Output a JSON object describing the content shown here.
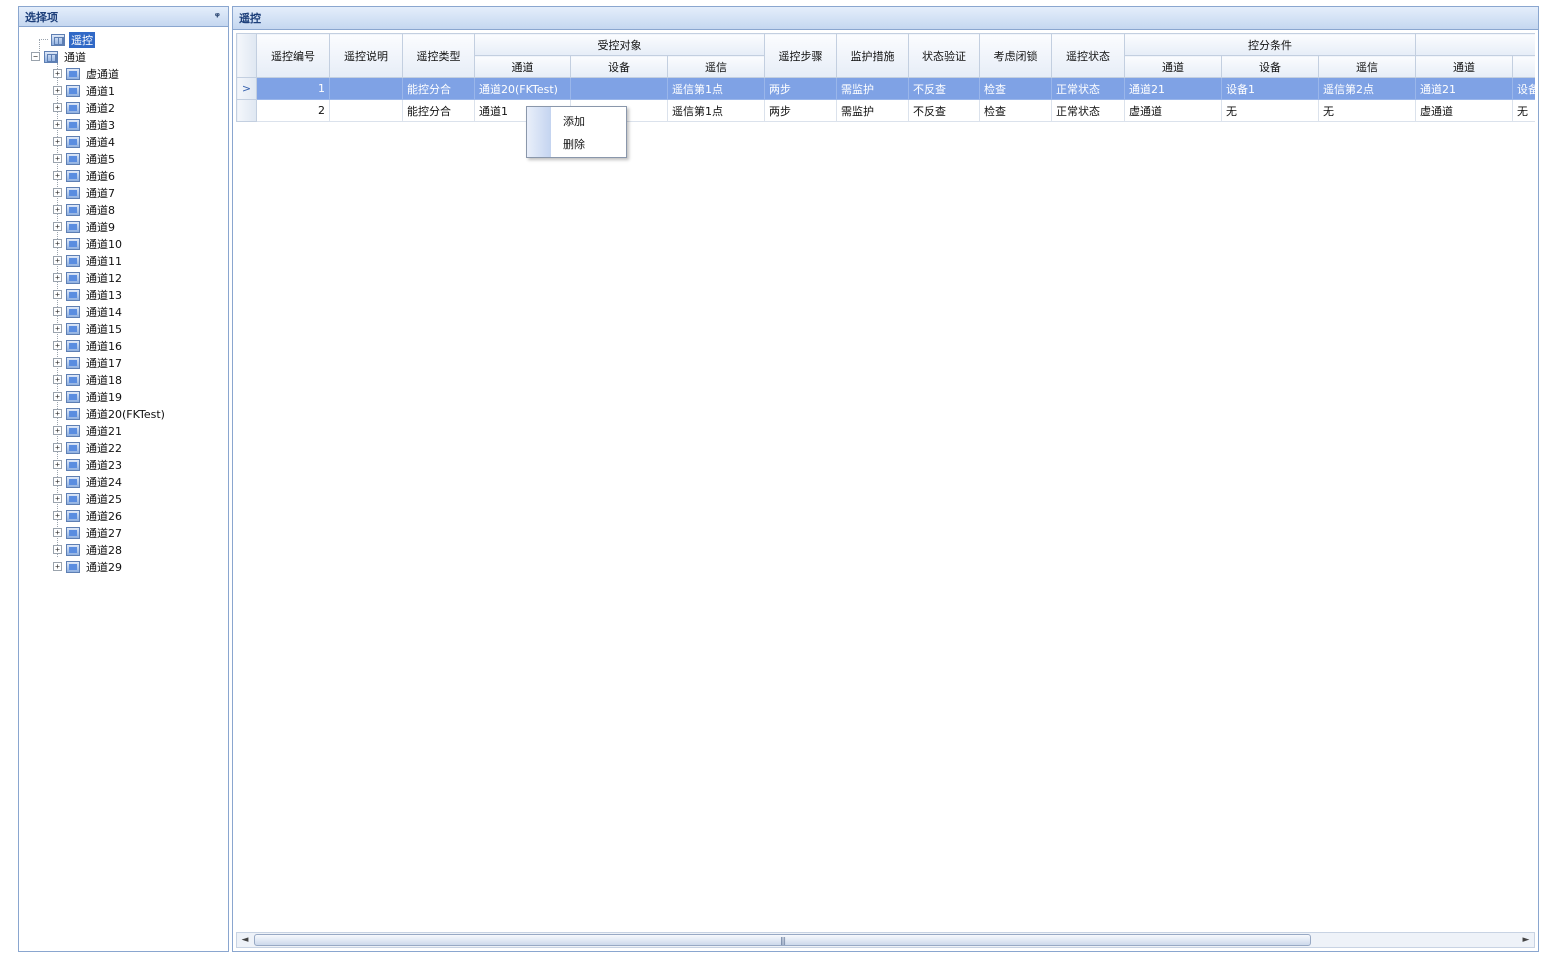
{
  "left_panel": {
    "title": "选择项",
    "pin_glyph": "ᵠ",
    "tree": {
      "root_label": "遥控",
      "channel_root": "通道",
      "channels": [
        "虚通道",
        "通道1",
        "通道2",
        "通道3",
        "通道4",
        "通道5",
        "通道6",
        "通道7",
        "通道8",
        "通道9",
        "通道10",
        "通道11",
        "通道12",
        "通道13",
        "通道14",
        "通道15",
        "通道16",
        "通道17",
        "通道18",
        "通道19",
        "通道20(FKTest)",
        "通道21",
        "通道22",
        "通道23",
        "通道24",
        "通道25",
        "通道26",
        "通道27",
        "通道28",
        "通道29"
      ]
    }
  },
  "right_panel": {
    "title": "遥控",
    "table": {
      "headers": {
        "id": "遥控编号",
        "desc": "遥控说明",
        "type": "遥控类型",
        "target_group": "受控对象",
        "target_channel": "通道",
        "target_device": "设备",
        "target_signal": "遥信",
        "steps": "遥控步骤",
        "monitor": "监护措施",
        "verify": "状态验证",
        "lock": "考虑闭锁",
        "state": "遥控状态",
        "cond_group": "控分条件",
        "cond_channel": "通道",
        "cond_device": "设备",
        "cond_signal": "遥信",
        "extra_channel": "通道"
      },
      "rows": [
        {
          "indicator": ">",
          "id": "1",
          "desc": "",
          "type": "能控分合",
          "t_channel": "通道20(FKTest)",
          "t_device": "",
          "t_signal": "遥信第1点",
          "steps": "两步",
          "monitor": "需监护",
          "verify": "不反查",
          "lock": "检查",
          "state": "正常状态",
          "c_channel": "通道21",
          "c_device": "设备1",
          "c_signal": "遥信第2点",
          "x_channel": "通道21",
          "x_device": "设备"
        },
        {
          "indicator": "",
          "id": "2",
          "desc": "",
          "type": "能控分合",
          "t_channel": "通道1",
          "t_device": "",
          "t_signal": "遥信第1点",
          "steps": "两步",
          "monitor": "需监护",
          "verify": "不反查",
          "lock": "检查",
          "state": "正常状态",
          "c_channel": "虚通道",
          "c_device": "无",
          "c_signal": "无",
          "x_channel": "虚通道",
          "x_device": "无"
        }
      ]
    },
    "context_menu": {
      "add": "添加",
      "delete": "删除"
    },
    "scrollbar": {
      "left_arrow": "◄",
      "right_arrow": "►",
      "grip": "|||"
    }
  }
}
